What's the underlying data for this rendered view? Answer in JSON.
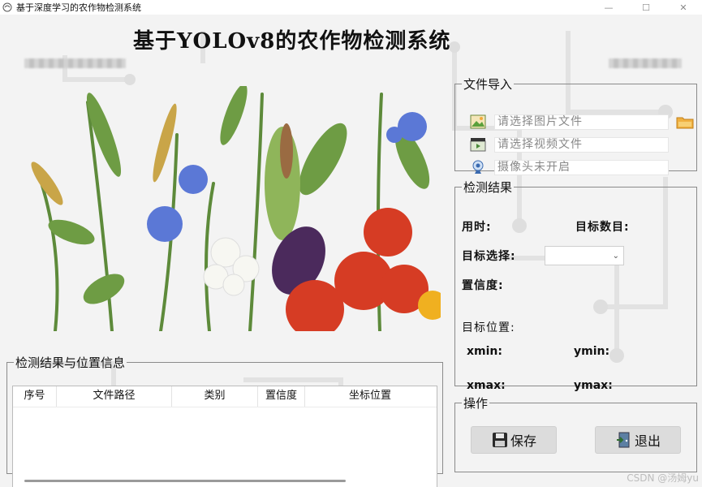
{
  "window": {
    "title": "基于深度学习的农作物检测系统",
    "controls": {
      "minimize": "—",
      "maximize": "☐",
      "close": "✕"
    }
  },
  "main_title": "基于YOLOv8的农作物检测系统",
  "file_import": {
    "legend": "文件导入",
    "image_placeholder": "请选择图片文件",
    "video_placeholder": "请选择视频文件",
    "camera_status": "摄像头未开启",
    "icons": [
      "image-icon",
      "video-icon",
      "camera-icon",
      "folder-icon"
    ]
  },
  "detection_result": {
    "legend": "检测结果",
    "time_label": "用时:",
    "target_count_label": "目标数目:",
    "target_select_label": "目标选择:",
    "target_select_value": "",
    "confidence_label": "置信度:",
    "target_position_label": "目标位置:",
    "xmin_label": "xmin:",
    "ymin_label": "ymin:",
    "xmax_label": "xmax:",
    "ymax_label": "ymax:"
  },
  "results_table": {
    "legend": "检测结果与位置信息",
    "columns": [
      "序号",
      "文件路径",
      "类别",
      "置信度",
      "坐标位置"
    ],
    "rows": []
  },
  "operations": {
    "legend": "操作",
    "save_label": "保存",
    "exit_label": "退出"
  },
  "watermark": "CSDN @汤姆yu",
  "colors": {
    "background": "#f3f3f3",
    "panel_border": "#8a8a8a",
    "button_bg": "#dcdcdc"
  }
}
